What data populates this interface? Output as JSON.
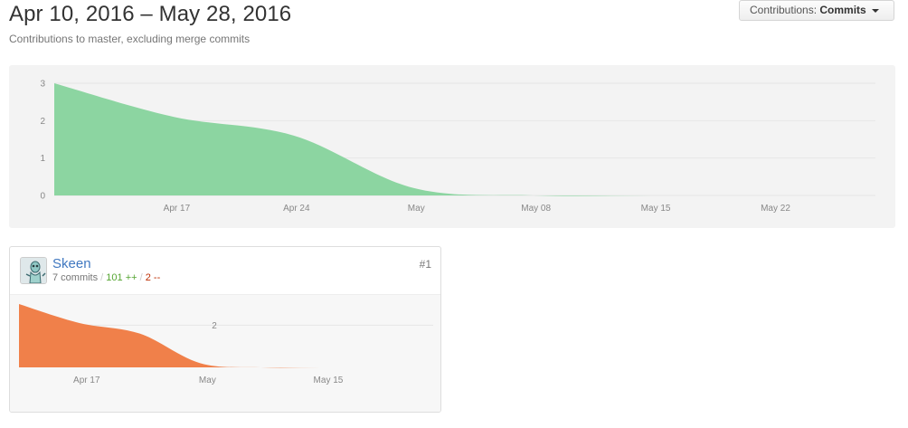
{
  "header": {
    "date_range": "Apr 10, 2016 – May 28, 2016",
    "subtitle": "Contributions to master, excluding merge commits"
  },
  "contributions_dropdown": {
    "label": "Contributions:",
    "value": "Commits"
  },
  "colors": {
    "main_fill": "#8cd5a1",
    "contributor_fill": "#f0804a",
    "panel_bg": "#f3f3f3",
    "link": "#4078c0",
    "additions": "#55a532",
    "deletions": "#bd2c00"
  },
  "contributor": {
    "name": "Skeen",
    "commits": "7 commits",
    "additions": "101 ++",
    "deletions": "2 --",
    "rank": "#1",
    "avatar": "avatar-icon"
  },
  "chart_data": [
    {
      "type": "area",
      "title": "",
      "x": [
        "2016-04-10",
        "2016-04-17",
        "2016-04-24",
        "2016-05-01",
        "2016-05-08",
        "2016-05-15",
        "2016-05-22",
        "2016-05-28"
      ],
      "x_tick_labels": [
        "Apr 17",
        "Apr 24",
        "May",
        "May 08",
        "May 15",
        "May 22"
      ],
      "series": [
        {
          "values": [
            3,
            2.1,
            1.6,
            0.2,
            0,
            0,
            0,
            0
          ]
        }
      ],
      "y_ticks": [
        "0",
        "1",
        "2",
        "3"
      ],
      "ylim": [
        0,
        3
      ],
      "grid": true
    },
    {
      "type": "area",
      "title": "",
      "x": [
        "2016-04-10",
        "2016-04-17",
        "2016-04-24",
        "2016-05-01",
        "2016-05-08",
        "2016-05-15",
        "2016-05-22",
        "2016-05-28"
      ],
      "x_tick_labels": [
        "Apr 17",
        "May",
        "May 15"
      ],
      "series": [
        {
          "values": [
            3,
            2.1,
            1.6,
            0.2,
            0,
            0,
            0,
            0
          ]
        }
      ],
      "y_ticks": [
        "2"
      ],
      "ylim": [
        0,
        3
      ],
      "grid": true
    }
  ]
}
